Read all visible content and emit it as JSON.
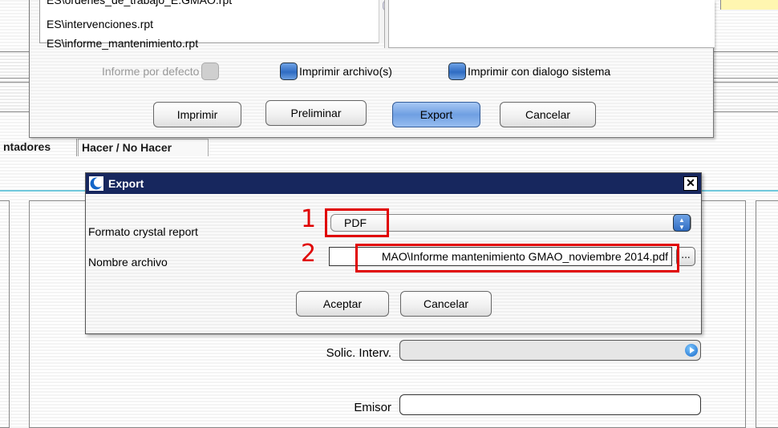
{
  "print_dialog": {
    "reports": [
      "ES\\ordenes_de_trabajo_E.GMAO.rpt",
      "ES\\intervenciones.rpt",
      "ES\\informe_mantenimiento.rpt"
    ],
    "options": {
      "default_report": "Informe por defecto",
      "print_files": "Imprimir archivo(s)",
      "print_system_dialog": "Imprimir con dialogo sistema"
    },
    "buttons": {
      "print": "Imprimir",
      "preview": "Preliminar",
      "export": "Export",
      "cancel": "Cancelar"
    }
  },
  "tabs": [
    "ntadores",
    "Hacer / No Hacer"
  ],
  "export_dialog": {
    "title": "Export",
    "close_symbol": "✕",
    "format_label": "Formato crystal report",
    "format_value": "PDF",
    "filename_label": "Nombre archivo",
    "filename_value": "MAO\\Informe mantenimiento GMAO_noviembre 2014.pdf",
    "browse_symbol": "...",
    "buttons": {
      "accept": "Aceptar",
      "cancel": "Cancelar"
    },
    "callouts": [
      "1",
      "2"
    ]
  },
  "form": {
    "solic_label": "Solic. Interv.",
    "solic_value": "",
    "emisor_label": "Emisor",
    "emisor_value": ""
  },
  "icons": {
    "export_app_icon": "crescent-logo-icon",
    "go_icon": "arrow-right-circle-icon",
    "scroll": "scroll-arrows-icon",
    "select": "updown-arrows-icon"
  },
  "colors": {
    "titlebar": "#17275e",
    "callout_red": "#e00000",
    "accent_blue": "#2f6cc2",
    "cyan_line": "#6fc8dc"
  }
}
